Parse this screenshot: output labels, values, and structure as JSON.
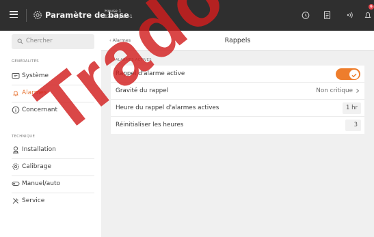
{
  "header": {
    "title": "Paramètre de base",
    "house_line1": "House 1",
    "house_line2": "12:34, Jour -1",
    "badge_count": "6",
    "icons": [
      "menu-icon",
      "gear-icon",
      "alarm-clock-icon",
      "document-icon",
      "signal-icon",
      "bell-icon"
    ]
  },
  "sidebar": {
    "search_placeholder": "Chercher",
    "section_general": "GÉNÉRALITÉS",
    "section_technical": "TECHNIQUE",
    "general_items": [
      {
        "label": "Système",
        "icon": "system-icon"
      },
      {
        "label": "Alarmes",
        "icon": "bell-icon",
        "active": true
      },
      {
        "label": "Concernant",
        "icon": "info-icon"
      }
    ],
    "technical_items": [
      {
        "label": "Installation",
        "icon": "installation-icon"
      },
      {
        "label": "Calibrage",
        "icon": "calibration-icon"
      },
      {
        "label": "Manuel/auto",
        "icon": "manual-auto-icon"
      },
      {
        "label": "Service",
        "icon": "service-icon"
      }
    ]
  },
  "main": {
    "back_label": "Alarmes",
    "page_title": "Rappels",
    "group_label": "ALARMES ACTIVES",
    "rows": [
      {
        "label": "Rappel d'alarme active",
        "type": "toggle",
        "value": true
      },
      {
        "label": "Gravité du rappel",
        "type": "select",
        "value": "Non critique"
      },
      {
        "label": "Heure du rappel d'alarmes actives",
        "type": "number",
        "value": "1 hr"
      },
      {
        "label": "Réinitialiser les heures",
        "type": "number",
        "value": "3"
      }
    ]
  },
  "colors": {
    "accent": "#ee7d2c",
    "topbar": "#2f2f2f",
    "badge": "#e5484d",
    "watermark": "#d21e1e"
  },
  "watermark_text": "Trado"
}
